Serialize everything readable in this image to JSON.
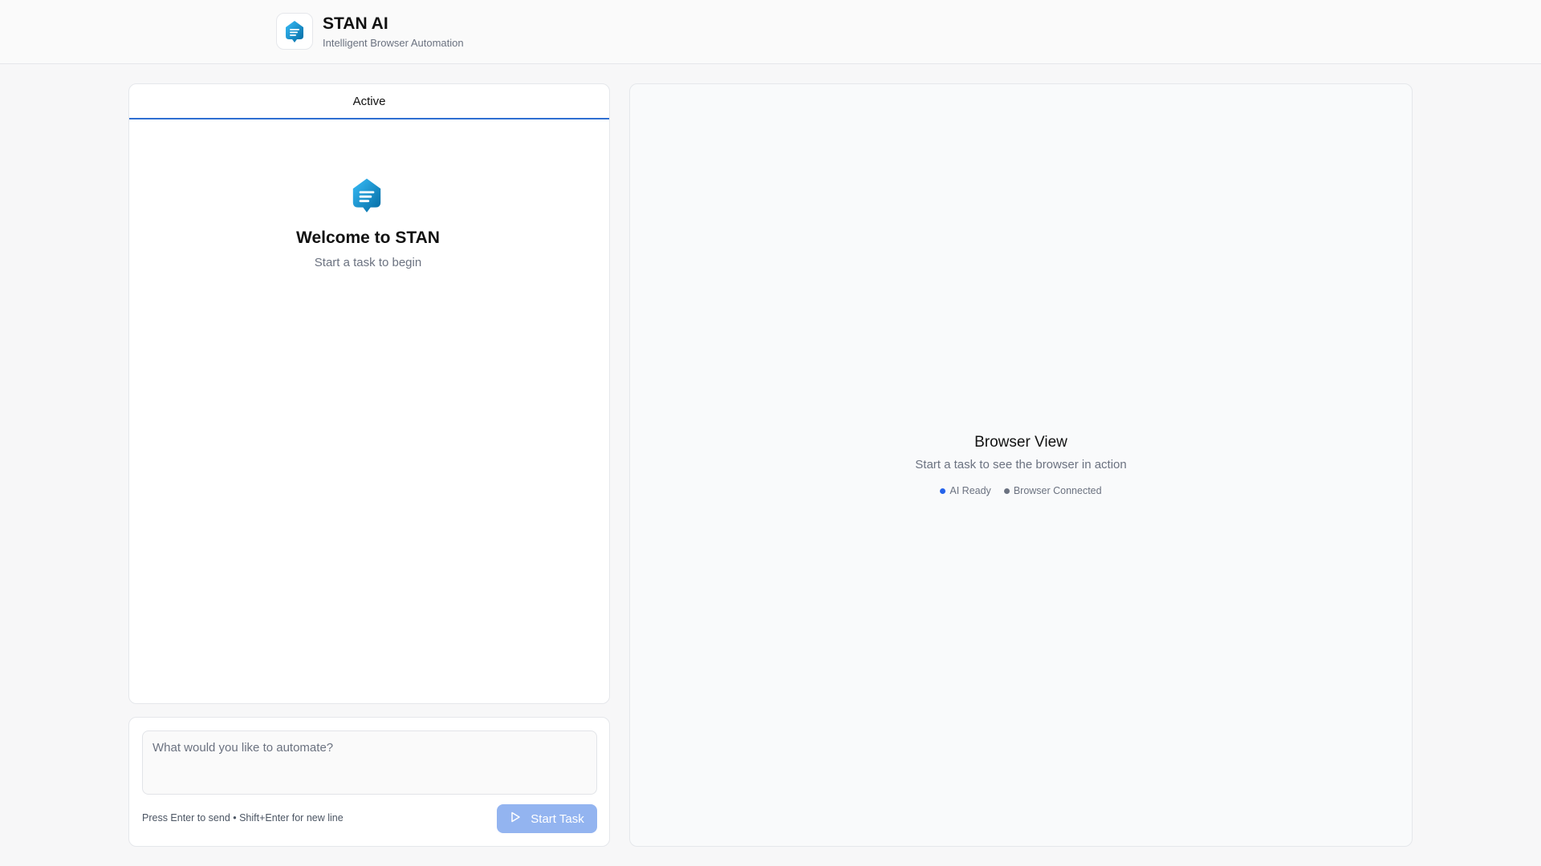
{
  "header": {
    "title": "STAN AI",
    "subtitle": "Intelligent Browser Automation",
    "logo_icon": "stan-logo-icon"
  },
  "left_panel": {
    "tabs": [
      {
        "label": "Active",
        "active": true
      }
    ],
    "welcome": {
      "title": "Welcome to STAN",
      "subtitle": "Start a task to begin"
    }
  },
  "composer": {
    "placeholder": "What would you like to automate?",
    "value": "",
    "hint": "Press Enter to send • Shift+Enter for new line",
    "button_label": "Start Task",
    "button_icon": "play-icon"
  },
  "browser_view": {
    "title": "Browser View",
    "subtitle": "Start a task to see the browser in action",
    "statuses": [
      {
        "label": "AI Ready",
        "color": "#2563eb"
      },
      {
        "label": "Browser Connected",
        "color": "#6b7280"
      }
    ]
  },
  "colors": {
    "accent": "#2f6fd1",
    "button_disabled": "#93b4f0",
    "logo_gradient_start": "#0ea5e9",
    "logo_gradient_end": "#1d4ed8"
  }
}
